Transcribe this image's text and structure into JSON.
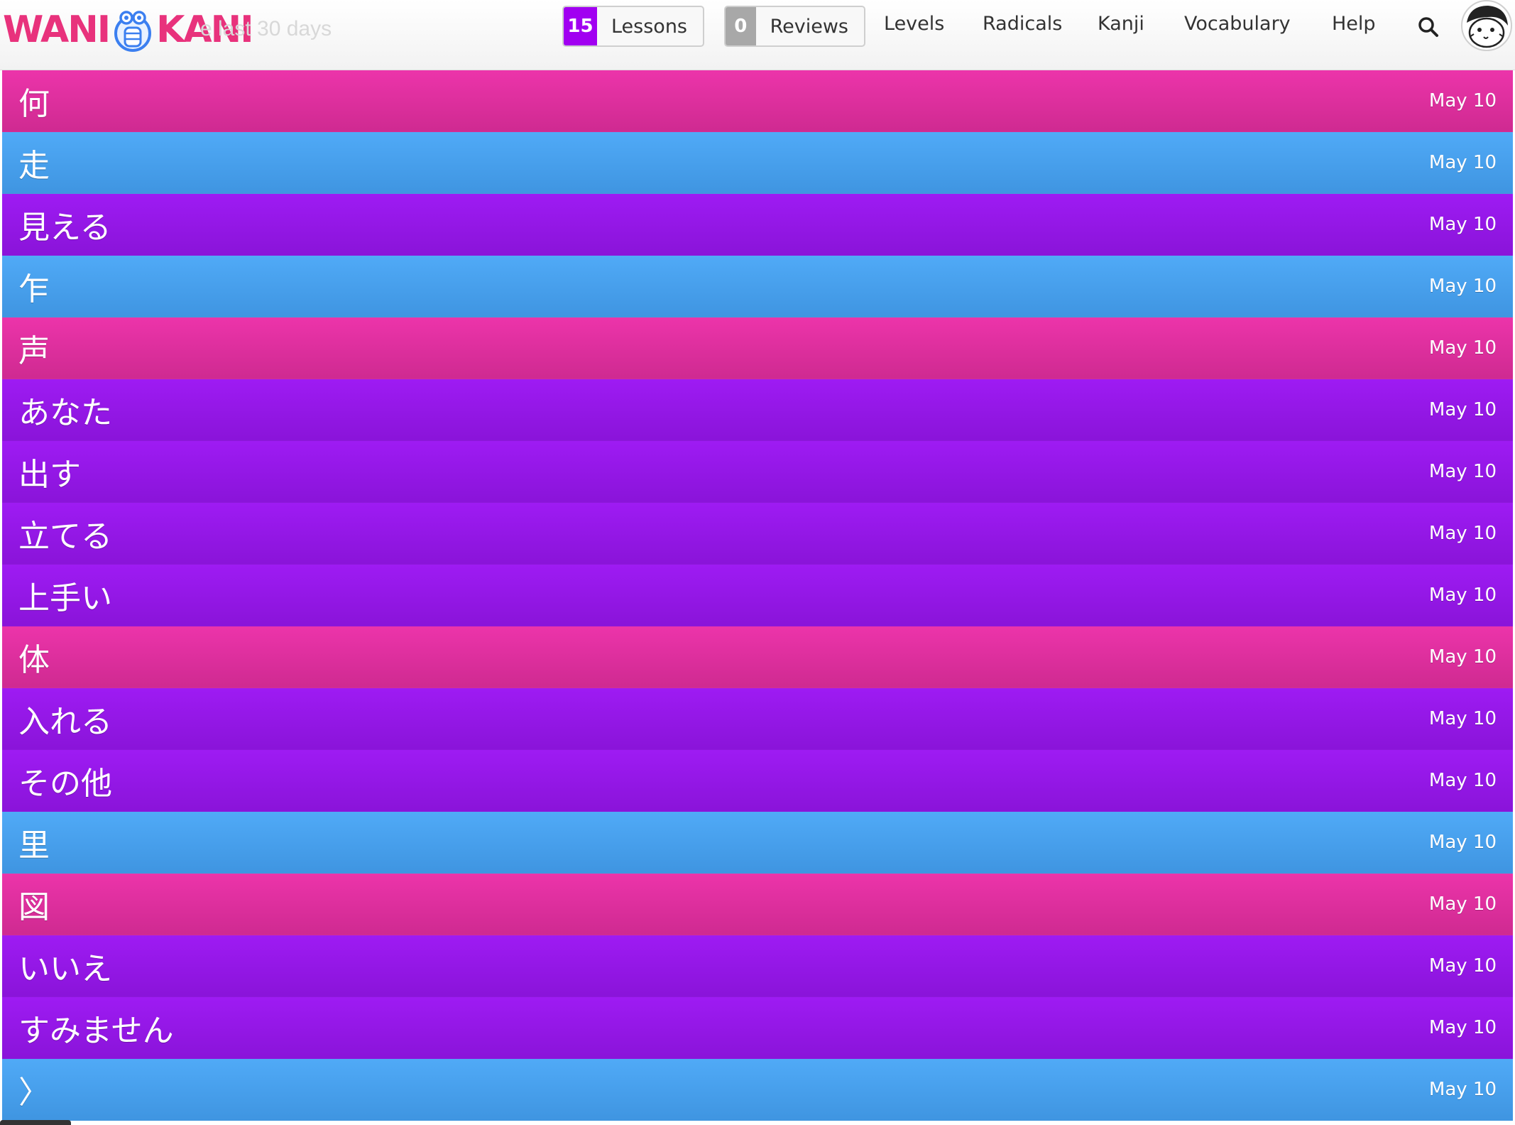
{
  "header": {
    "logo_left": "WANI",
    "logo_right": "KANI",
    "faded_text": "e last 30 days",
    "lessons": {
      "count": "15",
      "label": "Lessons"
    },
    "reviews": {
      "count": "0",
      "label": "Reviews"
    },
    "nav": [
      "Levels",
      "Radicals",
      "Kanji",
      "Vocabulary",
      "Help"
    ],
    "search_icon": "search-icon",
    "avatar_icon": "user-avatar-icon"
  },
  "colors": {
    "radical": "#4aa3f0",
    "kanji": "#e535a5",
    "vocabulary": "#9718ee",
    "lessons_badge": "#a100f1",
    "reviews_badge": "#a8a8a8",
    "logo": "#e8327c"
  },
  "items": [
    {
      "type": "kanji",
      "characters": "何",
      "date": "May 10"
    },
    {
      "type": "radical",
      "characters": "走",
      "date": "May 10"
    },
    {
      "type": "vocab",
      "characters": "見える",
      "date": "May 10"
    },
    {
      "type": "radical",
      "characters": "乍",
      "date": "May 10"
    },
    {
      "type": "kanji",
      "characters": "声",
      "date": "May 10"
    },
    {
      "type": "vocab",
      "characters": "あなた",
      "date": "May 10"
    },
    {
      "type": "vocab",
      "characters": "出す",
      "date": "May 10"
    },
    {
      "type": "vocab",
      "characters": "立てる",
      "date": "May 10"
    },
    {
      "type": "vocab",
      "characters": "上手い",
      "date": "May 10"
    },
    {
      "type": "kanji",
      "characters": "体",
      "date": "May 10"
    },
    {
      "type": "vocab",
      "characters": "入れる",
      "date": "May 10"
    },
    {
      "type": "vocab",
      "characters": "その他",
      "date": "May 10"
    },
    {
      "type": "radical",
      "characters": "里",
      "date": "May 10"
    },
    {
      "type": "kanji",
      "characters": "図",
      "date": "May 10"
    },
    {
      "type": "vocab",
      "characters": "いいえ",
      "date": "May 10"
    },
    {
      "type": "vocab",
      "characters": "すみません",
      "date": "May 10"
    },
    {
      "type": "radical",
      "characters": "〉",
      "date": "May 10"
    }
  ]
}
